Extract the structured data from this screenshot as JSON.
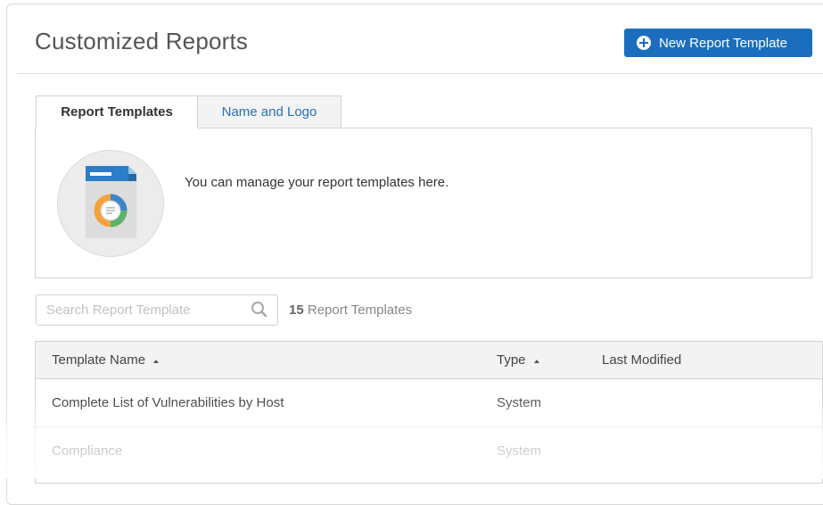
{
  "header": {
    "title": "Customized Reports",
    "new_button_label": "New Report Template"
  },
  "tabs": [
    {
      "label": "Report Templates",
      "active": true
    },
    {
      "label": "Name and Logo",
      "active": false
    }
  ],
  "panel": {
    "message": "You can manage your report templates here.",
    "illustration_icon": "report-document-icon"
  },
  "search": {
    "placeholder": "Search Report Template",
    "value": "",
    "icon": "search-icon"
  },
  "summary": {
    "count": "15",
    "label": "Report Templates"
  },
  "table": {
    "columns": [
      {
        "label": "Template Name",
        "sortable": true
      },
      {
        "label": "Type",
        "sortable": true
      },
      {
        "label": "Last Modified",
        "sortable": false
      }
    ],
    "rows": [
      {
        "name": "Complete List of Vulnerabilities by Host",
        "type": "System",
        "last_modified": ""
      },
      {
        "name": "Compliance",
        "type": "System",
        "last_modified": ""
      }
    ]
  },
  "colors": {
    "primary": "#1a6ebd",
    "link": "#2a6fb3",
    "tab_inactive_bg": "#f3f3f3",
    "header_bg": "#f3f3f3"
  }
}
